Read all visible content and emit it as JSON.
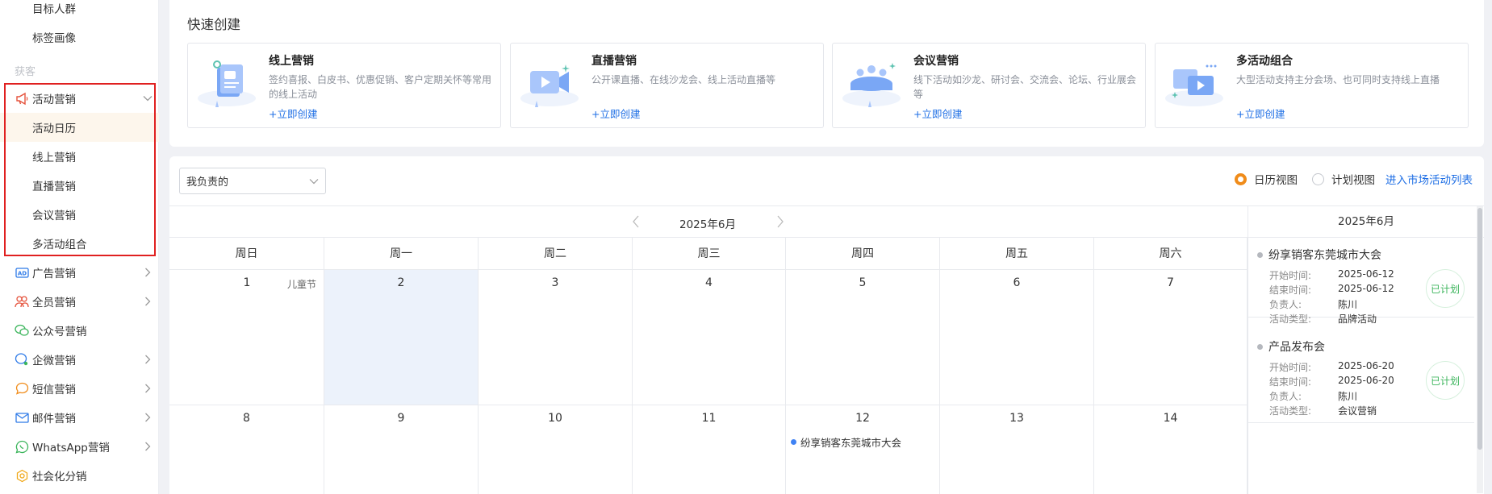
{
  "sidebar": {
    "top_items": [
      {
        "label": "目标人群"
      },
      {
        "label": "标签画像"
      }
    ],
    "group_label": "获客",
    "activity_marketing": {
      "label": "活动营销",
      "children": [
        {
          "label": "活动日历"
        },
        {
          "label": "线上营销"
        },
        {
          "label": "直播营销"
        },
        {
          "label": "会议营销"
        },
        {
          "label": "多活动组合"
        }
      ]
    },
    "menu_items": [
      {
        "label": "广告营销",
        "icon": "ad-icon",
        "has_arrow": true
      },
      {
        "label": "全员营销",
        "icon": "people-icon",
        "has_arrow": true
      },
      {
        "label": "公众号营销",
        "icon": "wechat-icon",
        "has_arrow": false
      },
      {
        "label": "企微营销",
        "icon": "wecom-icon",
        "has_arrow": true
      },
      {
        "label": "短信营销",
        "icon": "sms-icon",
        "has_arrow": true
      },
      {
        "label": "邮件营销",
        "icon": "mail-icon",
        "has_arrow": true
      },
      {
        "label": "WhatsApp营销",
        "icon": "whatsapp-icon",
        "has_arrow": true
      },
      {
        "label": "社会化分销",
        "icon": "share-icon",
        "has_arrow": false
      }
    ]
  },
  "quick_create": {
    "title": "快速创建",
    "link_label": "+立即创建",
    "cards": [
      {
        "name": "线上营销",
        "desc": "签约喜报、白皮书、优惠促销、客户定期关怀等常用的线上活动"
      },
      {
        "name": "直播营销",
        "desc": "公开课直播、在线沙龙会、线上活动直播等"
      },
      {
        "name": "会议营销",
        "desc": "线下活动如沙龙、研讨会、交流会、论坛、行业展会等"
      },
      {
        "name": "多活动组合",
        "desc": "大型活动支持主分会场、也可同时支持线上直播"
      }
    ]
  },
  "toolbar": {
    "owner_select": "我负责的",
    "calendar_view": "日历视图",
    "plan_view": "计划视图",
    "enter_list": "进入市场活动列表"
  },
  "calendar": {
    "month": "2025年6月",
    "weekdays": [
      "周日",
      "周一",
      "周二",
      "周三",
      "周四",
      "周五",
      "周六"
    ],
    "week1": [
      {
        "day": "1",
        "holiday": "儿童节"
      },
      {
        "day": "2",
        "today": true
      },
      {
        "day": "3"
      },
      {
        "day": "4"
      },
      {
        "day": "5"
      },
      {
        "day": "6"
      },
      {
        "day": "7"
      }
    ],
    "week2": [
      {
        "day": "8"
      },
      {
        "day": "9"
      },
      {
        "day": "10"
      },
      {
        "day": "11"
      },
      {
        "day": "12",
        "event": "纷享销客东莞城市大会"
      },
      {
        "day": "13"
      },
      {
        "day": "14"
      }
    ]
  },
  "side_panel": {
    "month": "2025年6月",
    "labels": {
      "start": "开始时间:",
      "end": "结束时间:",
      "owner": "负责人:",
      "type": "活动类型:"
    },
    "events": [
      {
        "title": "纷享销客东莞城市大会",
        "start": "2025-06-12",
        "end": "2025-06-12",
        "owner": "陈川",
        "type": "品牌活动",
        "status": "已计划"
      },
      {
        "title": "产品发布会",
        "start": "2025-06-20",
        "end": "2025-06-20",
        "owner": "陈川",
        "type": "会议营销",
        "status": "已计划"
      }
    ]
  },
  "colors": {
    "accent": "#f08c1a",
    "link": "#1f6fe5",
    "highlight_box": "#e02020",
    "status": "#3cb55c"
  }
}
